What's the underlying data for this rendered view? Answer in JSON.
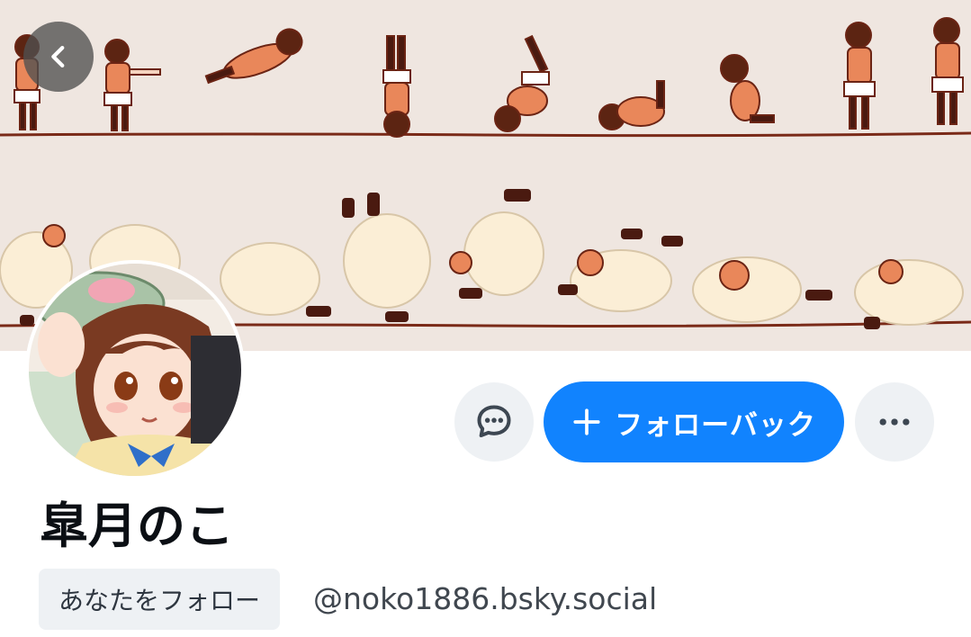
{
  "profile": {
    "display_name": "皐月のこ",
    "handle": "@noko1886.bsky.social",
    "follows_you_badge": "あなたをフォロー"
  },
  "actions": {
    "follow_back_label": "フォローバック"
  },
  "icons": {
    "back": "chevron-left-icon",
    "chat": "chat-bubble-icon",
    "plus": "plus-icon",
    "more": "ellipsis-icon"
  },
  "colors": {
    "accent": "#1183fe",
    "banner_bg": "#efe6e0",
    "button_gray": "#eef1f4",
    "text_primary": "#0b0f14",
    "text_secondary": "#40474f"
  }
}
